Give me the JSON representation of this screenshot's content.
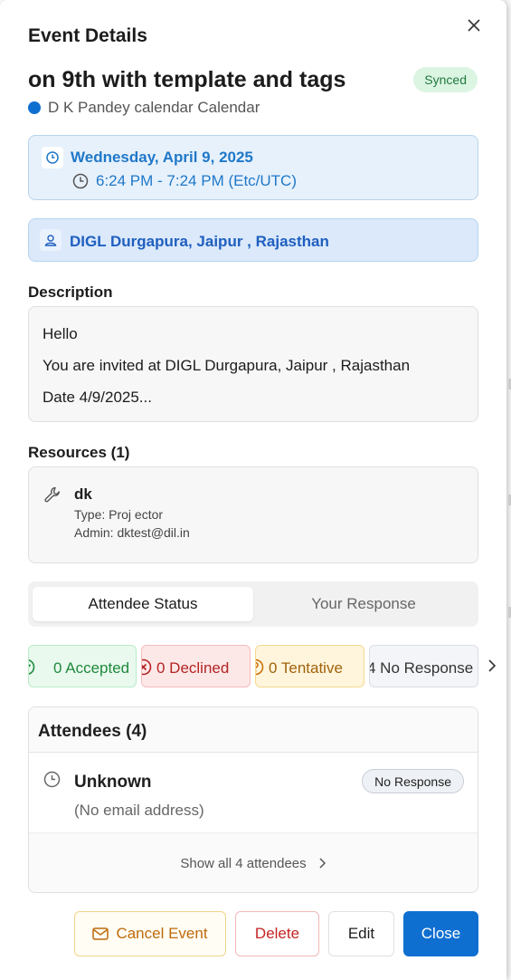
{
  "dialog": {
    "header_title": "Event Details",
    "event_title": "on 9th with template and tags",
    "sync_badge": "Synced",
    "calendar_name": "D K Pandey calendar Calendar"
  },
  "datetime": {
    "date": "Wednesday, April 9, 2025",
    "time": "6:24 PM - 7:24 PM (Etc/UTC)"
  },
  "location": {
    "text": "DIGL Durgapura, Jaipur , Rajasthan"
  },
  "description": {
    "label": "Description",
    "lines": [
      "Hello",
      "You are invited at DIGL Durgapura, Jaipur , Rajasthan",
      "Date 4/9/2025..."
    ]
  },
  "resources": {
    "label": "Resources (1)",
    "items": [
      {
        "name": "dk",
        "type": "Type: Proj ector",
        "admin": "Admin: dktest@dil.in"
      }
    ]
  },
  "tabs": [
    {
      "label": "Attendee Status",
      "active": true
    },
    {
      "label": "Your Response",
      "active": false
    }
  ],
  "status_counts": {
    "accepted": "0 Accepted",
    "declined": "0 Declined",
    "tentative": "0 Tentative",
    "no_response": "4 No Response"
  },
  "attendees": {
    "title": "Attendees (4)",
    "list": [
      {
        "name": "Unknown",
        "email": "(No email address)",
        "status": "No Response"
      }
    ],
    "show_all": "Show all 4 attendees"
  },
  "actions": {
    "cancel_event": "Cancel Event",
    "delete": "Delete",
    "edit": "Edit",
    "close": "Close"
  },
  "colors": {
    "accent": "#0f6fd1",
    "synced_bg": "#dcf5e3",
    "accepted": "#1f8a3c",
    "declined": "#b32424",
    "tentative": "#a0620b"
  }
}
